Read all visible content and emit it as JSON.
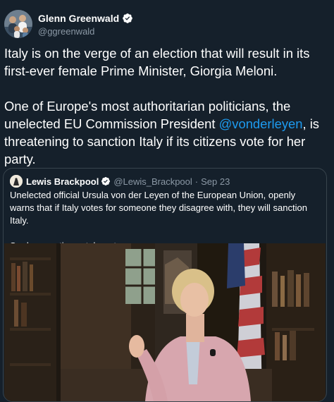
{
  "tweet": {
    "author": {
      "display_name": "Glenn Greenwald",
      "handle": "@ggreenwald",
      "verified_icon": "verified-badge-icon"
    },
    "paragraph_1": "Italy is on the verge of an election that will result in its first-ever female Prime Minister, Giorgia Meloni.",
    "paragraph_2_before": "One of Europe's most authoritarian politicians, the unelected EU Commission President ",
    "paragraph_2_mention": "@vonderleyen",
    "paragraph_2_after": ", is threatening to sanction Italy if its citizens vote for her party."
  },
  "quoted_tweet": {
    "author": {
      "display_name": "Lewis Brackpool",
      "handle": "@Lewis_Brackpool",
      "separator": "·",
      "date": "Sep 23"
    },
    "paragraph_1": "Unelected official Ursula von der Leyen of the European Union, openly warns that if Italy votes for someone they disagree with, they will sanction Italy.",
    "paragraph_2": "So democratic, so tolerant."
  },
  "colors": {
    "background": "#15202b",
    "text": "#ffffff",
    "secondary": "#8b98a5",
    "link": "#1d9bf0",
    "border": "#38444d"
  }
}
